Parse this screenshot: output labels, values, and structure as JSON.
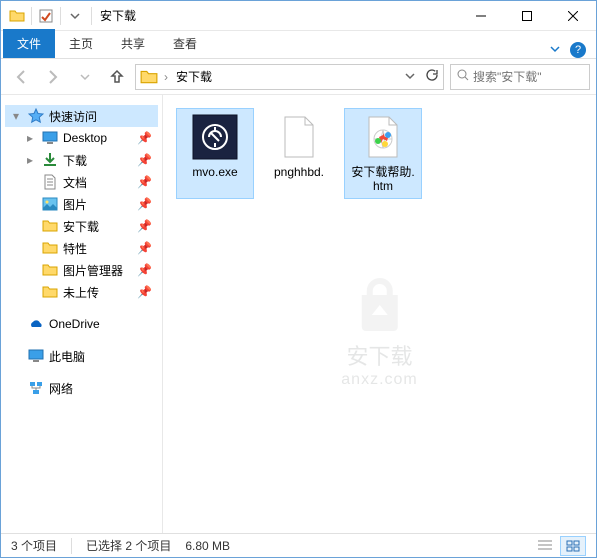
{
  "titlebar": {
    "title": "安下载"
  },
  "ribbon": {
    "tabs": {
      "file": "文件",
      "home": "主页",
      "share": "共享",
      "view": "查看"
    }
  },
  "nav": {
    "crumbs": [
      "安下载"
    ],
    "search_placeholder": "搜索\"安下载\""
  },
  "sidebar": {
    "quick_access": "快速访问",
    "items": [
      {
        "label": "Desktop",
        "icon": "desktop",
        "pinned": true
      },
      {
        "label": "下载",
        "icon": "downloads",
        "pinned": true
      },
      {
        "label": "文档",
        "icon": "documents",
        "pinned": true
      },
      {
        "label": "图片",
        "icon": "pictures",
        "pinned": true
      },
      {
        "label": "安下载",
        "icon": "folder",
        "pinned": true
      },
      {
        "label": "特性",
        "icon": "folder",
        "pinned": true
      },
      {
        "label": "图片管理器",
        "icon": "folder",
        "pinned": true
      },
      {
        "label": "未上传",
        "icon": "folder",
        "pinned": true
      }
    ],
    "onedrive": "OneDrive",
    "this_pc": "此电脑",
    "network": "网络"
  },
  "files": [
    {
      "name": "mvo.exe",
      "type": "exe",
      "selected": true
    },
    {
      "name": "pnghhbd.",
      "type": "blank",
      "selected": false
    },
    {
      "name": "安下载帮助.htm",
      "type": "htm",
      "selected": true
    }
  ],
  "watermark": {
    "text": "安下载",
    "sub": "anxz.com"
  },
  "status": {
    "count": "3 个项目",
    "selected": "已选择 2 个项目",
    "size": "6.80 MB"
  }
}
